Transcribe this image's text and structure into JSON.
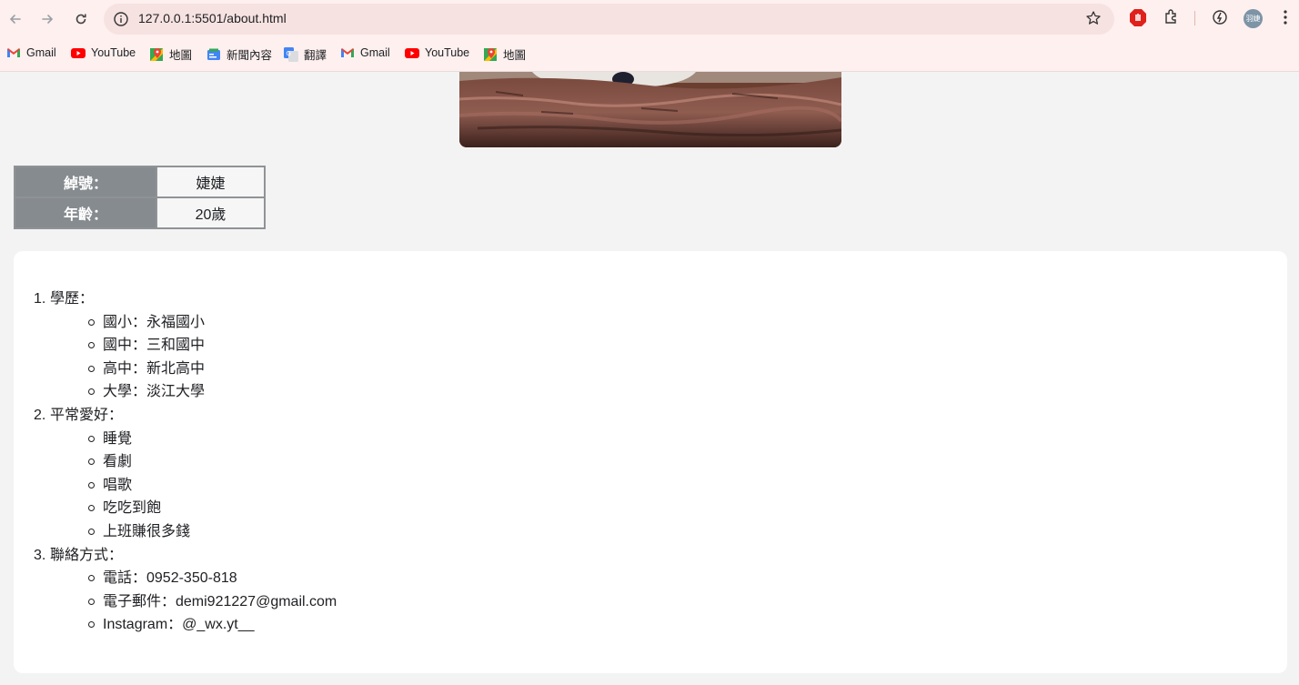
{
  "browser": {
    "url": "127.0.0.1:5501/about.html",
    "avatar_text": "羽婕",
    "bookmarks": [
      {
        "label": "Gmail",
        "icon": "gmail-icon"
      },
      {
        "label": "YouTube",
        "icon": "youtube-icon"
      },
      {
        "label": "地圖",
        "icon": "maps-icon"
      },
      {
        "label": "新聞內容",
        "icon": "news-icon"
      },
      {
        "label": "翻譯",
        "icon": "translate-icon"
      },
      {
        "label": "Gmail",
        "icon": "gmail-icon"
      },
      {
        "label": "YouTube",
        "icon": "youtube-icon"
      },
      {
        "label": "地圖",
        "icon": "maps-icon"
      }
    ]
  },
  "profile": {
    "rows": [
      {
        "key": "綽號：",
        "value": "婕婕"
      },
      {
        "key": "年齡：",
        "value": "20歲"
      }
    ]
  },
  "about": {
    "sections": [
      {
        "num": "1.",
        "title": "學歷：",
        "items": [
          "國小：永福國小",
          "國中：三和國中",
          "高中：新北高中",
          "大學：淡江大學"
        ]
      },
      {
        "num": "2.",
        "title": "平常愛好：",
        "items": [
          "睡覺",
          "看劇",
          "唱歌",
          "吃吃到飽",
          "上班賺很多錢"
        ]
      },
      {
        "num": "3.",
        "title": "聯絡方式：",
        "items": [
          "電話：0952-350-818",
          "電子郵件：demi921227@gmail.com",
          "Instagram：@_wx.yt__"
        ]
      }
    ]
  },
  "colors": {
    "page_bg": "#f3f3f3",
    "table_key_bg": "#868b8f",
    "chrome_bg": "#fdf0ef"
  }
}
